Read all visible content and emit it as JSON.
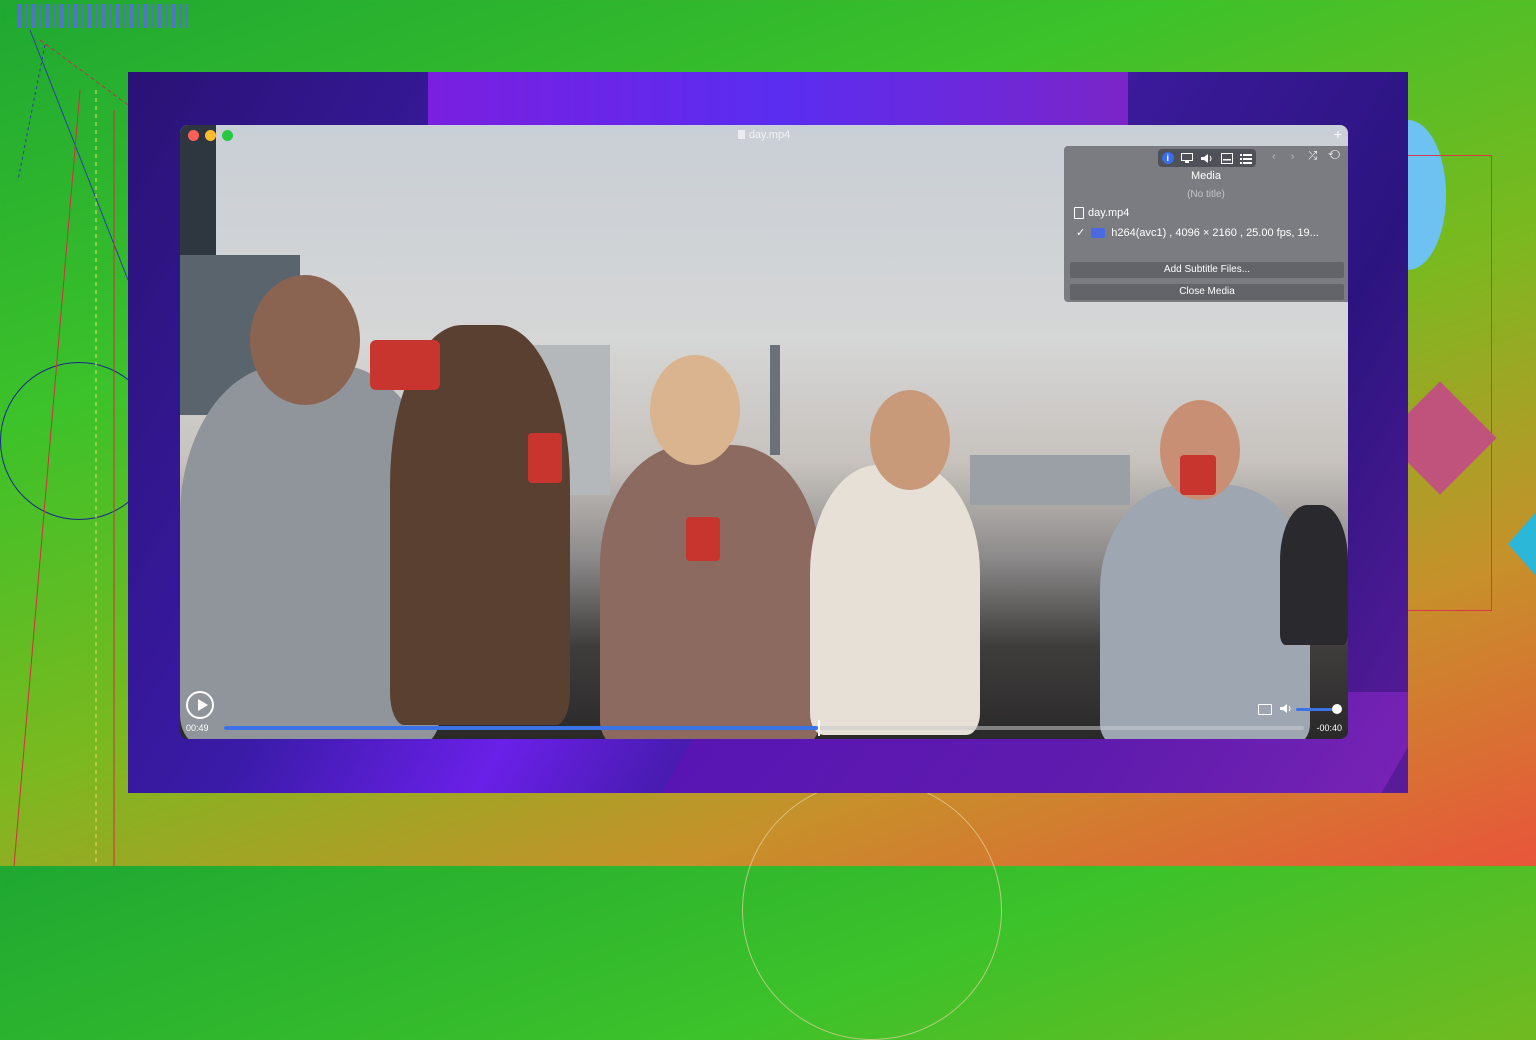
{
  "window": {
    "title": "day.mp4",
    "new_tab_glyph": "+"
  },
  "colors": {
    "accent": "#3b73e6",
    "traffic_close": "#ff5f57",
    "traffic_minimize": "#febc2e",
    "traffic_zoom": "#28c840"
  },
  "media_panel": {
    "toolbar_icons": [
      "info-icon",
      "display-icon",
      "audio-icon",
      "subtitle-icon",
      "playlist-icon"
    ],
    "info_glyph": "i",
    "nav_glyphs": "‹ ›",
    "shuffle_repeat_glyphs": "⤮ ⟲",
    "heading": "Media",
    "subheading": "(No title)",
    "file_name": "day.mp4",
    "track_check": "✓",
    "track_info": "h264(avc1) ,  4096 × 2160 , 25.00 fps, 19...",
    "add_subtitle_label": "Add Subtitle Files...",
    "close_media_label": "Close Media"
  },
  "controls": {
    "elapsed": "00:49",
    "remaining": "-00:40",
    "progress_fraction": 0.55,
    "volume_fraction": 1.0
  }
}
